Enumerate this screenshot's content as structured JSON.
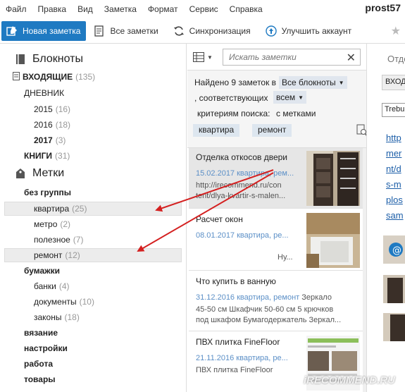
{
  "menu": {
    "items": [
      "Файл",
      "Правка",
      "Вид",
      "Заметка",
      "Формат",
      "Сервис",
      "Справка"
    ],
    "user": "prost57"
  },
  "toolbar": {
    "new_note": "Новая заметка",
    "all_notes": "Все заметки",
    "sync": "Синхронизация",
    "upgrade": "Улучшить аккаунт",
    "star_icon": "star-icon"
  },
  "sidebar": {
    "notebooks_header": "Блокноты",
    "inbox": {
      "label": "ВХОДЯЩИЕ",
      "count": "(135)"
    },
    "diary": {
      "label": "ДНЕВНИК"
    },
    "years": [
      {
        "label": "2015",
        "count": "(16)",
        "bold": false
      },
      {
        "label": "2016",
        "count": "(18)",
        "bold": false
      },
      {
        "label": "2017",
        "count": "(3)",
        "bold": true
      }
    ],
    "books": {
      "label": "КНИГИ",
      "count": "(31)"
    },
    "tags_header": "Метки",
    "no_group": "без группы",
    "tags": [
      {
        "label": "квартира",
        "count": "(25)"
      },
      {
        "label": "метро",
        "count": "(2)"
      },
      {
        "label": "полезное",
        "count": "(7)"
      },
      {
        "label": "ремонт",
        "count": "(12)"
      }
    ],
    "papers": "бумажки",
    "paper_tags": [
      {
        "label": "банки",
        "count": "(4)"
      },
      {
        "label": "документы",
        "count": "(10)"
      },
      {
        "label": "законы",
        "count": "(18)"
      }
    ],
    "groups": [
      "вязание",
      "настройки",
      "работа",
      "товары"
    ]
  },
  "middle": {
    "search_placeholder": "Искать заметки",
    "found_text": "Найдено 9 заметок в",
    "notebooks_dd": "Все блокноты",
    "matching_text": ", соответствующих",
    "all_dd": "всем",
    "criteria_text": "критериям поиска:",
    "with_tags": "с метками",
    "filter_tags": [
      "квартира",
      "ремонт"
    ],
    "notes": [
      {
        "title": "Отделка откосов двери",
        "meta": "15.02.2017  квартира, рем...",
        "snippet1": "http://irecommend.ru/con",
        "snippet2": "tent/dlya-kvartir-s-malen..."
      },
      {
        "title": "Расчет окон",
        "meta": "08.01.2017  квартира, ре...",
        "snippet1": "Ну..."
      },
      {
        "title": "Что купить в ванную",
        "meta": "31.12.2016  квартира, ремонт",
        "meta_tail": " Зеркало",
        "snippet1": "45-50 см Шкафчик 50-60 см 5 крючков",
        "snippet2": "под шкафом Бумагодержатель Зеркал..."
      },
      {
        "title": "ПВХ плитка FineFloor",
        "meta": "21.11.2016  квартира, ре...",
        "snippet1": "ПВХ плитка FineFloor"
      }
    ]
  },
  "right": {
    "title": "Отде",
    "notebook_dd": "ВХОД",
    "font": "Trebu",
    "links": [
      "http",
      "mer",
      "nt/d",
      "s-m",
      "plos",
      "sam"
    ]
  },
  "watermark": "iRECOMMEND.RU",
  "colors": {
    "accent": "#1f7ac2",
    "link": "#1c5ea8",
    "arrow": "#d42020"
  }
}
